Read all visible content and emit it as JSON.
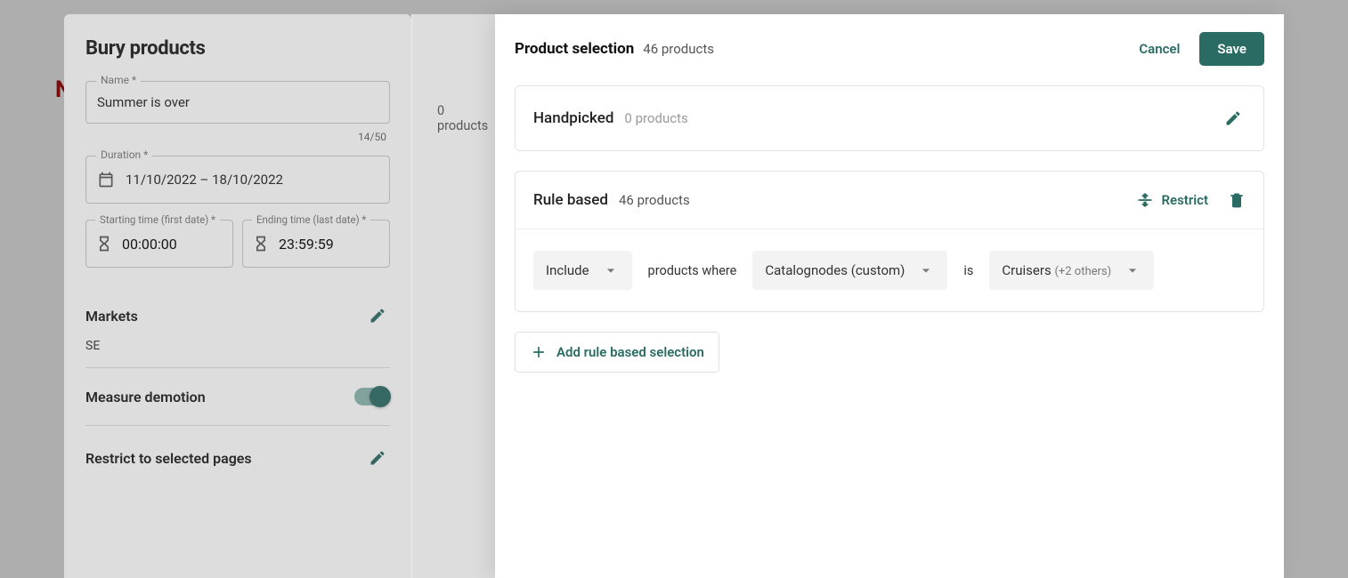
{
  "left": {
    "title": "Bury products",
    "name_label": "Name *",
    "name_value": "Summer is over",
    "name_counter": "14/50",
    "duration_label": "Duration *",
    "duration_value": "11/10/2022 – 18/10/2022",
    "start_label": "Starting time (first date) *",
    "start_value": "00:00:00",
    "end_label": "Ending time (last date) *",
    "end_value": "23:59:59",
    "markets_title": "Markets",
    "markets_value": "SE",
    "measure_title": "Measure demotion",
    "restrict_title": "Restrict to selected pages"
  },
  "mid": {
    "products_label": "0 products"
  },
  "right": {
    "header_title": "Product selection",
    "header_count": "46 products",
    "cancel": "Cancel",
    "save": "Save",
    "handpicked": {
      "title": "Handpicked",
      "count": "0 products"
    },
    "rule": {
      "title": "Rule based",
      "count": "46 products",
      "restrict_label": "Restrict",
      "dd_include": "Include",
      "products_where": "products where",
      "dd_attr": "Catalognodes (custom)",
      "is": "is",
      "dd_val": "Cruisers",
      "dd_val_extra": "(+2 others)"
    },
    "add_rule": "Add rule based selection"
  }
}
